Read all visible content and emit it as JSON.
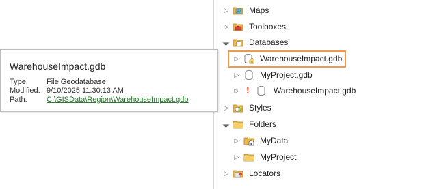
{
  "catalog": {
    "items": [
      {
        "label": "Maps",
        "icon": "maps-folder-icon"
      },
      {
        "label": "Toolboxes",
        "icon": "toolbox-folder-icon"
      },
      {
        "label": "Databases",
        "icon": "database-folder-icon"
      },
      {
        "label": "WarehouseImpact.gdb",
        "icon": "geodatabase-default-icon"
      },
      {
        "label": "MyProject.gdb",
        "icon": "geodatabase-icon"
      },
      {
        "label": "WarehouseImpact.gdb",
        "icon": "geodatabase-icon",
        "status": "!"
      },
      {
        "label": "Styles",
        "icon": "styles-folder-icon"
      },
      {
        "label": "Folders",
        "icon": "folders-icon"
      },
      {
        "label": "MyData",
        "icon": "home-folder-icon"
      },
      {
        "label": "MyProject",
        "icon": "folder-icon"
      },
      {
        "label": "Locators",
        "icon": "locator-folder-icon"
      }
    ]
  },
  "tooltip": {
    "title": "WarehouseImpact.gdb",
    "type_key": "Type:",
    "type_value": "File Geodatabase",
    "modified_key": "Modified:",
    "modified_value": "9/10/2025 11:30:13 AM",
    "path_key": "Path:",
    "path_value": "C:\\GISData\\Region\\WarehouseImpact.gdb"
  },
  "colors": {
    "highlight": "#f29a49",
    "warning": "#e0301e",
    "link": "#2a7d2e"
  }
}
